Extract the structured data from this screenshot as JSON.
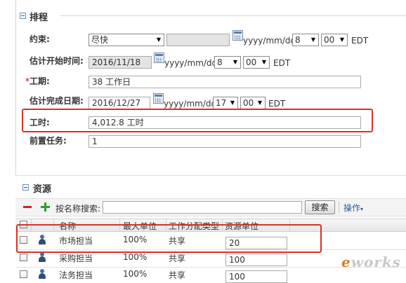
{
  "schedule": {
    "title": "排程",
    "constraint": {
      "label": "约束:",
      "type_value": "尽快",
      "date_value": "",
      "date_format": "yyyy/mm/dd",
      "hour": "8",
      "minute": "00",
      "tz": "EDT"
    },
    "est_start": {
      "label": "估计开始时间:",
      "date_value": "2016/11/18",
      "date_format": "yyyy/mm/dd",
      "hour": "8",
      "minute": "00",
      "tz": "EDT"
    },
    "duration": {
      "required_mark": "*",
      "label": "工期:",
      "value": "38 工作日"
    },
    "est_finish": {
      "label": "估计完成日期:",
      "date_value": "2016/12/27",
      "date_format": "yyyy/mm/dd",
      "hour": "17",
      "minute": "00",
      "tz": "EDT"
    },
    "work": {
      "label": "工时:",
      "value": "4,012.8 工时"
    },
    "predecessors": {
      "label": "前置任务:",
      "value": "1"
    }
  },
  "resources": {
    "title": "资源",
    "search_label": "按名称搜索:",
    "search_value": "",
    "search_button": "搜索",
    "actions_menu": "操作",
    "columns": [
      "名称",
      "最大单位",
      "工作分配类型",
      "资源单位"
    ],
    "rows": [
      {
        "name": "市场担当",
        "max_units": "100%",
        "assign_type": "共享",
        "units": "20"
      },
      {
        "name": "采购担当",
        "max_units": "100%",
        "assign_type": "共享",
        "units": "100"
      },
      {
        "name": "法务担当",
        "max_units": "100%",
        "assign_type": "共享",
        "units": "100"
      }
    ]
  },
  "watermark": {
    "prefix": "e",
    "suffix": "works"
  }
}
